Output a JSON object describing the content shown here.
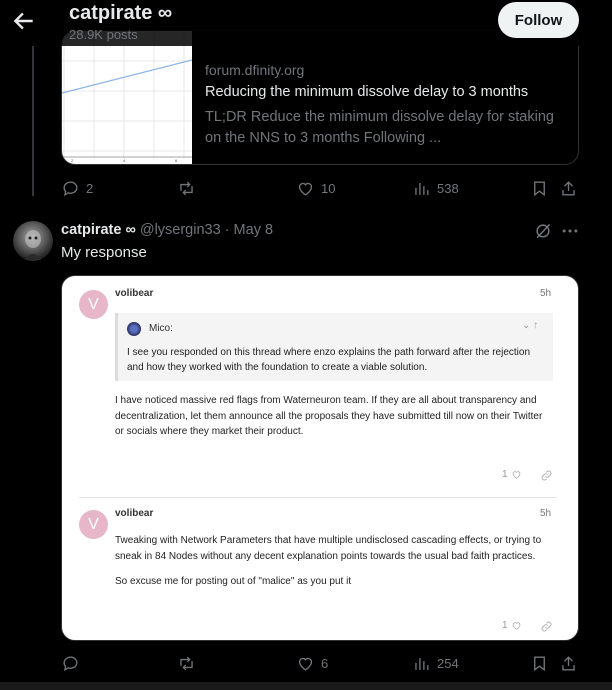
{
  "header": {
    "title": "catpirate ∞",
    "subtitle": "28.9K posts",
    "follow_label": "Follow"
  },
  "link_card": {
    "domain": "forum.dfinity.org",
    "title": "Reducing the minimum dissolve delay to 3 months",
    "description": "TL;DR Reduce the minimum dissolve delay for staking on the NNS to 3 months Following ...",
    "thumb_ticks": [
      "2",
      "4",
      "6"
    ]
  },
  "first_actions": {
    "replies": "2",
    "reposts": "",
    "likes": "10",
    "views": "538"
  },
  "tweet": {
    "name": "catpirate ∞",
    "handle": "@lysergin33",
    "separator": " · ",
    "date": "May 8",
    "text": "My response"
  },
  "forum": {
    "posts": [
      {
        "avatar_letter": "V",
        "username": "volibear",
        "time": "5h",
        "quote": {
          "author": "Mico:",
          "controls": "⌄ ↑",
          "text": "I see you responded on this thread where enzo explains the path forward after the rejection and how they worked with the foundation to create a viable solution."
        },
        "paragraphs": [
          "I have noticed massive red flags from Waterneuron team. If they are all about transparency and decentralization, let them announce all the proposals they have submitted till now on their Twitter or socials where they market their product."
        ],
        "likes": "1"
      },
      {
        "avatar_letter": "V",
        "username": "volibear",
        "time": "5h",
        "paragraphs": [
          "Tweaking with Network Parameters that have multiple undisclosed cascading effects, or trying to sneak in 84 Nodes without any decent explanation points towards the usual bad faith practices.",
          "So excuse me for posting out of \"malice\" as you put it"
        ],
        "likes": "1"
      }
    ]
  },
  "second_actions": {
    "replies": "",
    "reposts": "",
    "likes": "6",
    "views": "254"
  },
  "icons": {
    "back": "arrow-left-icon",
    "reply": "reply-icon",
    "repost": "repost-icon",
    "like": "heart-icon",
    "views": "views-icon",
    "bookmark": "bookmark-icon",
    "share": "share-icon",
    "grok": "grok-icon",
    "more": "more-icon"
  },
  "colors": {
    "background": "#000000",
    "text": "#e7e9ea",
    "muted": "#71767b",
    "border": "#2f3336",
    "forum_avatar": "#e7b6c8"
  }
}
